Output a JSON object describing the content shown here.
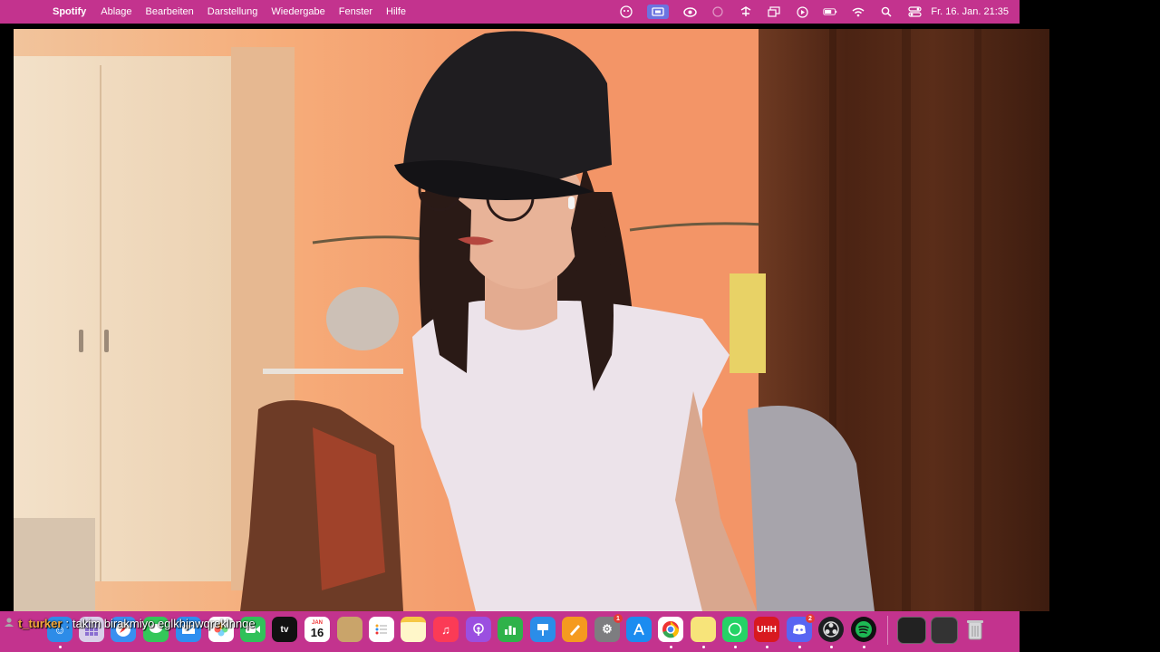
{
  "menubar": {
    "apple_glyph": "",
    "app_name": "Spotify",
    "items": [
      "Ablage",
      "Bearbeiten",
      "Darstellung",
      "Wiedergabe",
      "Fenster",
      "Hilfe"
    ],
    "clock": "Fr. 16. Jan.  21:35",
    "status_icons": [
      "face-icon",
      "screen-share-icon",
      "creative-cloud-icon",
      "record-icon",
      "network-icon",
      "display-icon",
      "play-icon",
      "battery-icon",
      "wifi-icon",
      "search-icon",
      "control-center-icon"
    ],
    "color": "#c3338e"
  },
  "chat": {
    "username": "t_turker",
    "separator": ":",
    "message": "takim birakmiyo eglkhjnwqreklnnqe",
    "username_color": "#f2a73a"
  },
  "dock": {
    "calendar_month": "JAN",
    "calendar_day": "16",
    "tv_label": "tv",
    "settings_badge": "1",
    "discord_badge": "2",
    "apps": [
      "finder",
      "launchpad",
      "safari",
      "messages",
      "mail",
      "photos",
      "facetime",
      "apple-tv",
      "calendar",
      "notes",
      "reminders",
      "notes-app",
      "music",
      "podcasts",
      "numbers",
      "keynote",
      "pages",
      "system-settings",
      "app-store",
      "chrome",
      "stickies",
      "whatsapp",
      "uhh",
      "discord",
      "obs",
      "spotify",
      "window-1",
      "window-2",
      "trash"
    ]
  }
}
